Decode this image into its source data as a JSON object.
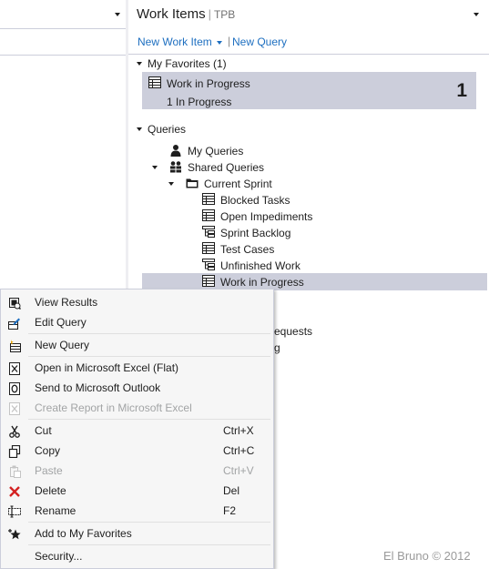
{
  "panel": {
    "title": "Work Items",
    "separator": "|",
    "project": "TPB",
    "new_work_item": "New Work Item",
    "link_separator": "|",
    "new_query": "New Query"
  },
  "favorites": {
    "header": "My Favorites (1)",
    "tile": {
      "name": "Work in Progress",
      "subtitle": "1 In Progress",
      "count": "1"
    }
  },
  "queries": {
    "header": "Queries",
    "my_queries": "My Queries",
    "shared_queries": "Shared Queries",
    "current_sprint": "Current Sprint",
    "items": [
      {
        "label": "Blocked Tasks",
        "icon": "flat-list-query-icon"
      },
      {
        "label": "Open Impediments",
        "icon": "flat-list-query-icon"
      },
      {
        "label": "Sprint Backlog",
        "icon": "tree-query-icon"
      },
      {
        "label": "Test Cases",
        "icon": "flat-list-query-icon"
      },
      {
        "label": "Unfinished Work",
        "icon": "tree-query-icon"
      },
      {
        "label": "Work in Progress",
        "icon": "flat-list-query-icon",
        "selected": true
      }
    ],
    "partial_1": "equests",
    "partial_2": "g"
  },
  "context_menu": {
    "items": [
      {
        "label": "View Results",
        "shortcut": "",
        "enabled": true,
        "icon": "view-results-icon"
      },
      {
        "label": "Edit Query",
        "shortcut": "",
        "enabled": true,
        "icon": "edit-query-icon"
      },
      {
        "label": "New Query",
        "shortcut": "",
        "enabled": true,
        "icon": "new-query-icon"
      },
      {
        "label": "Open in Microsoft Excel (Flat)",
        "shortcut": "",
        "enabled": true,
        "icon": "excel-icon"
      },
      {
        "label": "Send to Microsoft Outlook",
        "shortcut": "",
        "enabled": true,
        "icon": "outlook-icon"
      },
      {
        "label": "Create Report in Microsoft Excel",
        "shortcut": "",
        "enabled": false,
        "icon": "excel-report-icon"
      },
      {
        "label": "Cut",
        "shortcut": "Ctrl+X",
        "enabled": true,
        "icon": "cut-icon"
      },
      {
        "label": "Copy",
        "shortcut": "Ctrl+C",
        "enabled": true,
        "icon": "copy-icon"
      },
      {
        "label": "Paste",
        "shortcut": "Ctrl+V",
        "enabled": false,
        "icon": "paste-icon"
      },
      {
        "label": "Delete",
        "shortcut": "Del",
        "enabled": true,
        "icon": "delete-icon"
      },
      {
        "label": "Rename",
        "shortcut": "F2",
        "enabled": true,
        "icon": "rename-icon"
      },
      {
        "label": "Add to My Favorites",
        "shortcut": "",
        "enabled": true,
        "icon": "favorites-icon"
      },
      {
        "label": "Security...",
        "shortcut": "",
        "enabled": true,
        "icon": ""
      }
    ]
  },
  "watermark": "El Bruno © 2012",
  "colors": {
    "accent": "#1e6fc0",
    "selection": "#cccedb",
    "menu_background": "#f6f6f6",
    "disabled_text": "#a2a4a5",
    "delete_red": "#d42222"
  }
}
